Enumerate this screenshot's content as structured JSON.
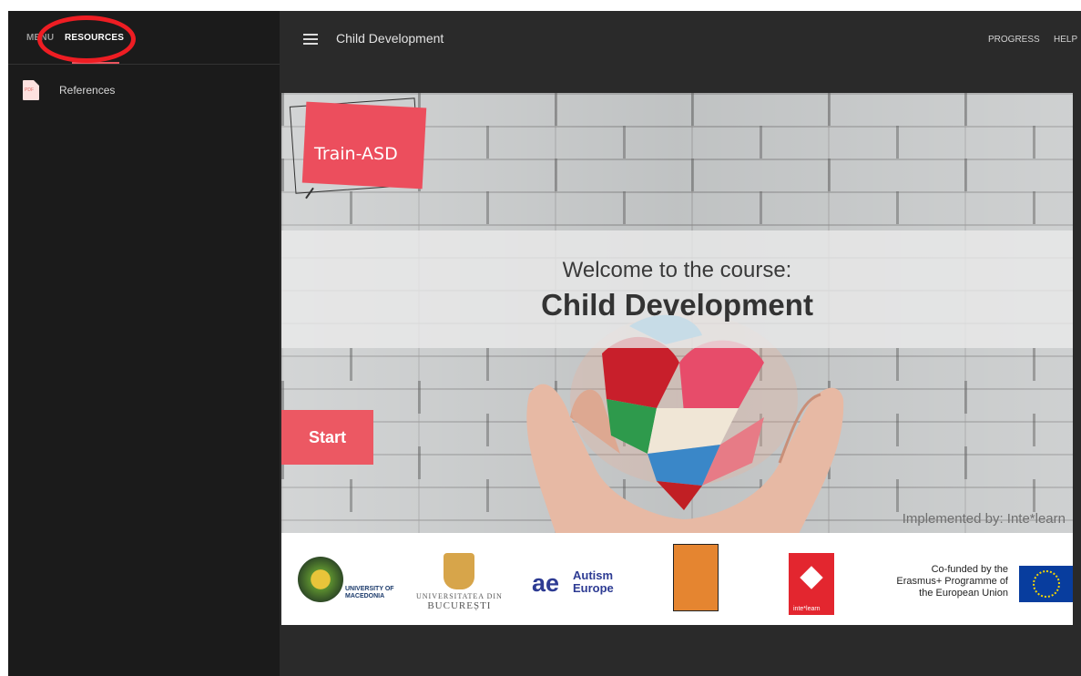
{
  "sidebar": {
    "tabs": {
      "menu": "MENU",
      "resources": "RESOURCES"
    },
    "items": [
      {
        "label": "References",
        "icon": "pdf-file-icon",
        "icon_text": "PDF"
      }
    ]
  },
  "topbar": {
    "title": "Child Development",
    "nav": {
      "progress": "PROGRESS",
      "help": "HELP"
    }
  },
  "hero": {
    "logo_text": "Train-ASD",
    "welcome": "Welcome to the course:",
    "course_name": "Child Development",
    "start_label": "Start",
    "implemented_by": "Implemented by: Inte*learn"
  },
  "partners": {
    "uom": "UNIVERSITY OF MACEDONIA",
    "ub_line1": "UNIVERSITATEA DIN",
    "ub_line2": "BUCUREȘTI",
    "ae_mark": "ae",
    "ae_line1": "Autism",
    "ae_line2": "Europe",
    "inte": "inte*learn",
    "eu_text": "Co-funded by the Erasmus+ Programme of the European Union"
  },
  "colors": {
    "accent": "#ec5863",
    "annotation_ring": "#ee1d23",
    "dark_bg": "#2a2a2a",
    "sidebar_bg": "#1b1b1b"
  }
}
